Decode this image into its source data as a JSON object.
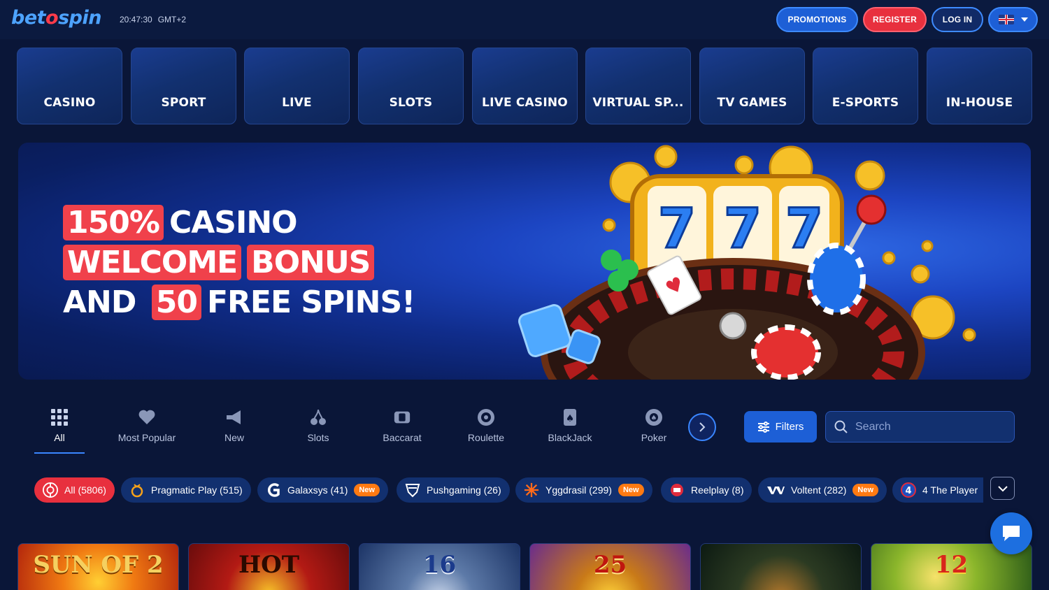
{
  "header": {
    "logo": {
      "part1": "bet",
      "part2": "o",
      "part3": "spin"
    },
    "time": "20:47:30",
    "timezone": "GMT+2",
    "promotions_label": "PROMOTIONS",
    "register_label": "REGISTER",
    "login_label": "LOG IN",
    "language_icon": "uk-flag-icon"
  },
  "categories": [
    "CASINO",
    "SPORT",
    "LIVE",
    "SLOTS",
    "LIVE CASINO",
    "VIRTUAL SP...",
    "TV GAMES",
    "E-SPORTS",
    "IN-HOUSE"
  ],
  "banner": {
    "line1_highlight": "150%",
    "line1_text": "CASINO",
    "line2_highlight_a": "WELCOME",
    "line2_highlight_b": "BONUS",
    "line3_text_a": "AND",
    "line3_highlight": "50",
    "line3_text_b": "FREE SPINS!"
  },
  "game_tabs": [
    {
      "label": "All",
      "icon": "grid-icon"
    },
    {
      "label": "Most Popular",
      "icon": "heart-icon"
    },
    {
      "label": "New",
      "icon": "megaphone-icon"
    },
    {
      "label": "Slots",
      "icon": "cherry-icon"
    },
    {
      "label": "Baccarat",
      "icon": "cards-icon"
    },
    {
      "label": "Roulette",
      "icon": "roulette-icon"
    },
    {
      "label": "BlackJack",
      "icon": "spade-card-icon"
    },
    {
      "label": "Poker",
      "icon": "poker-chip-icon"
    }
  ],
  "filters_label": "Filters",
  "search": {
    "placeholder": "Search"
  },
  "providers": [
    {
      "label": "All (5806)",
      "badge": ""
    },
    {
      "label": "Pragmatic Play (515)",
      "badge": ""
    },
    {
      "label": "Galaxsys (41)",
      "badge": "New"
    },
    {
      "label": "Pushgaming (26)",
      "badge": ""
    },
    {
      "label": "Yggdrasil (299)",
      "badge": "New"
    },
    {
      "label": "Reelplay (8)",
      "badge": ""
    },
    {
      "label": "Voltent (282)",
      "badge": "New"
    },
    {
      "label": "4 The Player",
      "badge": ""
    }
  ],
  "games": [
    {
      "title": "SUN OF 2"
    },
    {
      "title": "HOT"
    },
    {
      "title": "16"
    },
    {
      "title": "25"
    },
    {
      "title": ""
    },
    {
      "title": "12"
    }
  ],
  "colors": {
    "accent_blue": "#1d5fd6",
    "accent_red": "#e8303e",
    "badge_orange": "#ff7a12",
    "background": "#0a1638"
  }
}
